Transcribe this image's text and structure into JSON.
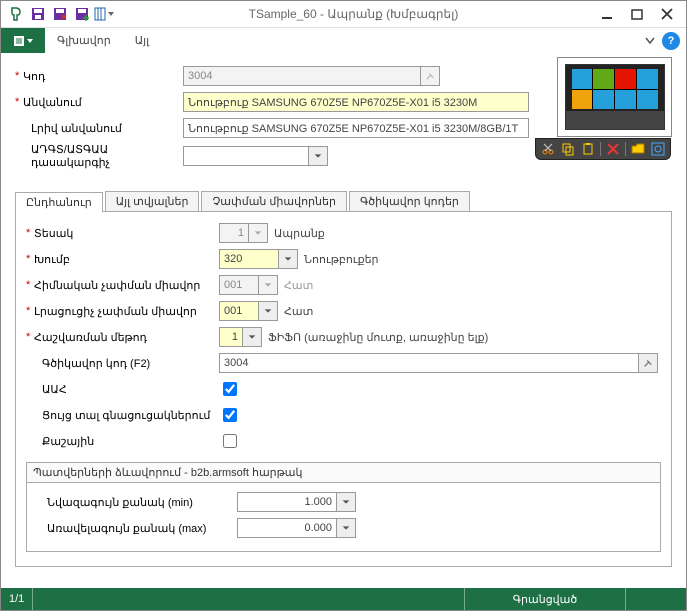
{
  "window": {
    "title": "TSample_60 - Ապրանք (Խմբագրել)"
  },
  "menubar": {
    "items": [
      "Գլխավոր",
      "Այլ"
    ]
  },
  "header": {
    "code_label": "Կոդ",
    "code_value": "3004",
    "name_label": "Անվանում",
    "name_value": "Նոութբուք SAMSUNG 670Z5E NP670Z5E-X01 i5 3230M",
    "fullname_label": "Լրիվ անվանում",
    "fullname_value": "Նոութբուք SAMSUNG 670Z5E NP670Z5E-X01 i5 3230M/8GB/1T",
    "class_label": "ԱԴԳՏ/ԱՏԳԱԱ դասակարգիչ",
    "class_value": ""
  },
  "tabs": [
    "Ընդհանուր",
    "Այլ տվյալներ",
    "Չափման միավորներ",
    "Գծիկավոր կոդեր"
  ],
  "general": {
    "type_label": "Տեսակ",
    "type_value": "1",
    "type_suffix": "Ապրանք",
    "group_label": "Խումբ",
    "group_value": "320",
    "group_suffix": "Նոութբուքեր",
    "baseunit_label": "Հիմնական չափման միավոր",
    "baseunit_value": "001",
    "baseunit_suffix": "Հատ",
    "addunit_label": "Լրացուցիչ չափման միավոր",
    "addunit_value": "001",
    "addunit_suffix": "Հատ",
    "calcmethod_label": "Հաշվառման մեթոդ",
    "calcmethod_value": "1",
    "calcmethod_suffix": "ՖԻՖՈ (առաջինը մուտք, առաջինը ելք)",
    "barcode_label": "Գծիկավոր կոդ (F2)",
    "barcode_value": "3004",
    "vat_label": "ԱԱՀ",
    "show_label": "Ցույց տալ գնացուցակներում",
    "weight_label": "Քաշային",
    "group_title": "Պատվերների ձևավորում - b2b.armsoft հարթակ",
    "minqty_label": "Նվազագույն քանակ (min)",
    "minqty_value": "1.000",
    "maxqty_label": "Առավելագույն քանակ (max)",
    "maxqty_value": "0.000"
  },
  "status": {
    "left": "1/1",
    "right": "Գրանցված"
  }
}
